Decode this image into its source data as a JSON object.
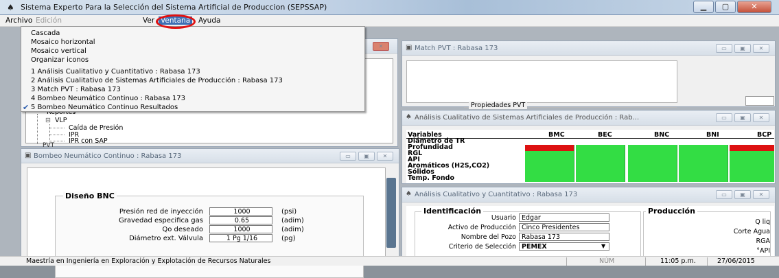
{
  "window": {
    "title": "Sistema Experto Para la Selección del Sistema Artificial de Produccion (SEPSSAP)"
  },
  "menubar": {
    "items": [
      "Archivo",
      "Edición",
      "Ver",
      "Ventana",
      "Ayuda"
    ]
  },
  "ventana_menu": {
    "items": [
      "Cascada",
      "Mosaico horizontal",
      "Mosaico vertical",
      "Organizar iconos",
      "1 Análisis Cualitativo y Cuantitativo : Rabasa 173",
      "2 Análisis Cualitativo de Sistemas Artificiales de Producción : Rabasa 173",
      "3 Match PVT : Rabasa 173",
      "4 Bombeo Neumático Continuo : Rabasa 173",
      "5 Bombeo Neumático Continuo Resultados"
    ]
  },
  "tree": {
    "items": [
      "Reportes",
      "VLP",
      "Caída de Presión",
      "IPR",
      "IPR con SAP",
      "PVT"
    ]
  },
  "match_pvt": {
    "title": "Match PVT : Rabasa 173",
    "group_label": "Propiedades PVT"
  },
  "analisis_sap": {
    "title": "Análisis Cualitativo de Sistemas Artificiales de Producción : Rab...",
    "columns": [
      "Variables",
      "BMC",
      "BEC",
      "BNC",
      "BNI",
      "BCP"
    ],
    "rows": [
      {
        "name": "Diámetro de TR",
        "cells": [
          "",
          "",
          "",
          "",
          ""
        ]
      },
      {
        "name": "Profundidad",
        "cells": [
          "red",
          "green",
          "green",
          "green",
          "red"
        ]
      },
      {
        "name": "RGL",
        "cells": [
          "green",
          "green",
          "green",
          "green",
          "green"
        ]
      },
      {
        "name": "API",
        "cells": [
          "green",
          "green",
          "green",
          "green",
          "green"
        ]
      },
      {
        "name": "Aromáticos (H2S,CO2)",
        "cells": [
          "green",
          "green",
          "green",
          "green",
          "green"
        ]
      },
      {
        "name": "Sólidos",
        "cells": [
          "green",
          "green",
          "green",
          "green",
          "green"
        ]
      },
      {
        "name": "Temp. Fondo",
        "cells": [
          "green",
          "green",
          "green",
          "green",
          "green"
        ]
      }
    ],
    "colors": {
      "green": "#33dd44",
      "red": "#dd1111"
    }
  },
  "bombeo": {
    "title": "Bombeo Neumático Continuo : Rabasa 173",
    "group_label": "Diseño BNC",
    "fields": [
      {
        "label": "Presión red de inyección",
        "value": "1000",
        "unit": "(psi)"
      },
      {
        "label": "Gravedad especifica gas",
        "value": "0.65",
        "unit": "(adim)"
      },
      {
        "label": "Qo deseado",
        "value": "1000",
        "unit": "(adim)"
      },
      {
        "label": "Diámetro ext. Válvula",
        "value": "1 Pg 1/16",
        "unit": "(pg)"
      }
    ]
  },
  "analisis_cc": {
    "title": "Análisis Cualitativo y Cuantitativo : Rabasa 173",
    "identificacion_label": "Identificación",
    "produccion_label": "Producción",
    "fields": [
      {
        "label": "Usuario",
        "value": "Edgar"
      },
      {
        "label": "Activo de Producción",
        "value": "Cinco Presidentes"
      },
      {
        "label": "Nombre del Pozo",
        "value": "Rabasa 173"
      },
      {
        "label": "Criterio de Selección",
        "value": "PEMEX"
      }
    ],
    "produccion_items": [
      "Q liq",
      "Corte Agua",
      "RGA",
      "°API"
    ]
  },
  "statusbar": {
    "text": "Maestría en Ingeniería en Exploración y Explotación de Recursos Naturales",
    "num": "NÚM",
    "time": "11:05 p.m.",
    "date": "27/06/2015"
  }
}
